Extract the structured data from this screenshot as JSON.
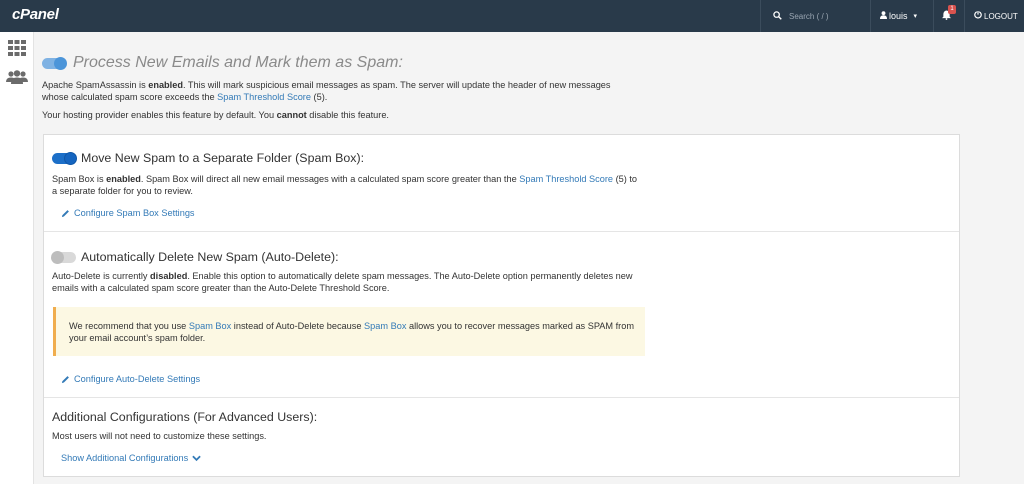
{
  "topbar": {
    "brand": "cPanel",
    "search_placeholder": "Search ( / )",
    "user_name": "louis",
    "notification_count": "1",
    "logout_label": "LOGOUT"
  },
  "main": {
    "title": "Process New Emails and Mark them as Spam:",
    "desc1_a": "Apache SpamAssassin is ",
    "desc1_b": "enabled",
    "desc1_c": ". This will mark suspicious email messages as spam. The server will update the header of new messages whose calculated spam score exceeds the ",
    "desc1_link": "Spam Threshold Score",
    "desc1_d": " (5).",
    "desc2_a": "Your hosting provider enables this feature by default. You ",
    "desc2_b": "cannot",
    "desc2_c": " disable this feature."
  },
  "spambox": {
    "title": "Move New Spam to a Separate Folder (Spam Box):",
    "desc_a": "Spam Box is ",
    "desc_b": "enabled",
    "desc_c": ". Spam Box will direct all new email messages with a calculated spam score greater than the ",
    "desc_link": "Spam Threshold Score",
    "desc_d": " (5) to a separate folder for you to review.",
    "configure_label": "Configure Spam Box Settings"
  },
  "autodelete": {
    "title": "Automatically Delete New Spam (Auto-Delete):",
    "desc_a": "Auto-Delete is currently ",
    "desc_b": "disabled",
    "desc_c": ". Enable this option to automatically delete spam messages. The Auto-Delete option permanently deletes new emails with a calculated spam score greater than the Auto-Delete Threshold Score.",
    "warn_a": "We recommend that you use ",
    "warn_link1": "Spam Box",
    "warn_b": " instead of Auto-Delete because ",
    "warn_link2": "Spam Box",
    "warn_c": " allows you to recover messages marked as SPAM from your email account’s spam folder.",
    "configure_label": "Configure Auto-Delete Settings"
  },
  "advanced": {
    "title": "Additional Configurations (For Advanced Users):",
    "desc": "Most users will not need to customize these settings.",
    "show_label": "Show Additional Configurations"
  },
  "colors": {
    "topbar": "#293a4a",
    "link": "#337ab7",
    "toggle_on": "#1565c0",
    "warning_border": "#f0ad4e"
  },
  "icons": [
    "search-icon",
    "user-icon",
    "bell-icon",
    "logout-icon",
    "grid-icon",
    "users-icon",
    "pencil-icon",
    "chevron-down-icon"
  ]
}
